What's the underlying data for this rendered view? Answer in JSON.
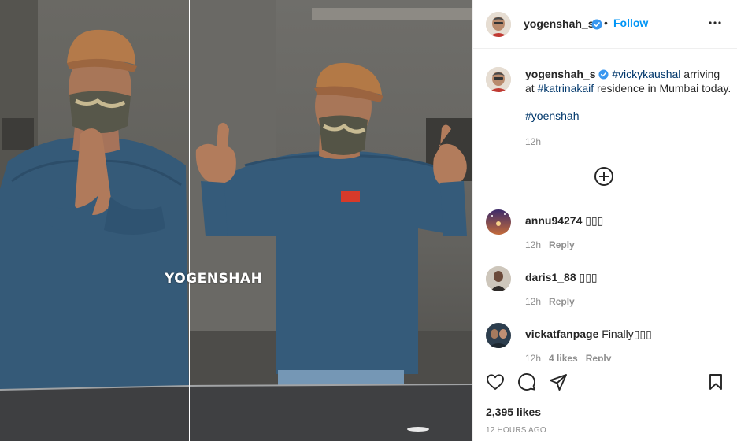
{
  "post": {
    "author": "yogenshah_s",
    "dot": "•",
    "follow_label": "Follow",
    "watermark": "YOGENSHAH",
    "caption": {
      "tag1": "#vickykaushal",
      "text1": " arriving at ",
      "tag2": "#katrinakaif",
      "text2": " residence in Mumbai today.",
      "hashtag": "#yoenshah",
      "time": "12h"
    },
    "comments": [
      {
        "user": "annu94274",
        "text": " ▯▯▯",
        "time": "12h",
        "likes": "",
        "reply": "Reply"
      },
      {
        "user": "daris1_88",
        "text": " ▯▯▯",
        "time": "12h",
        "likes": "",
        "reply": "Reply"
      },
      {
        "user": "vickatfanpage",
        "text": " Finally▯▯▯",
        "time": "12h",
        "likes": "4 likes",
        "reply": "Reply"
      }
    ],
    "likes": "2,395 likes",
    "posted": "12 HOURS AGO"
  },
  "icons": {
    "verified": "verified-badge-icon",
    "more": "more-options-icon",
    "load_more": "plus-circle-icon",
    "like": "heart-icon",
    "comment": "comment-bubble-icon",
    "share": "paper-plane-icon",
    "save": "bookmark-icon"
  },
  "colors": {
    "follow_blue": "#0095f6",
    "hashtag_blue": "#00376b",
    "meta_gray": "#8e8e8e",
    "verified_blue": "#3897f0"
  }
}
